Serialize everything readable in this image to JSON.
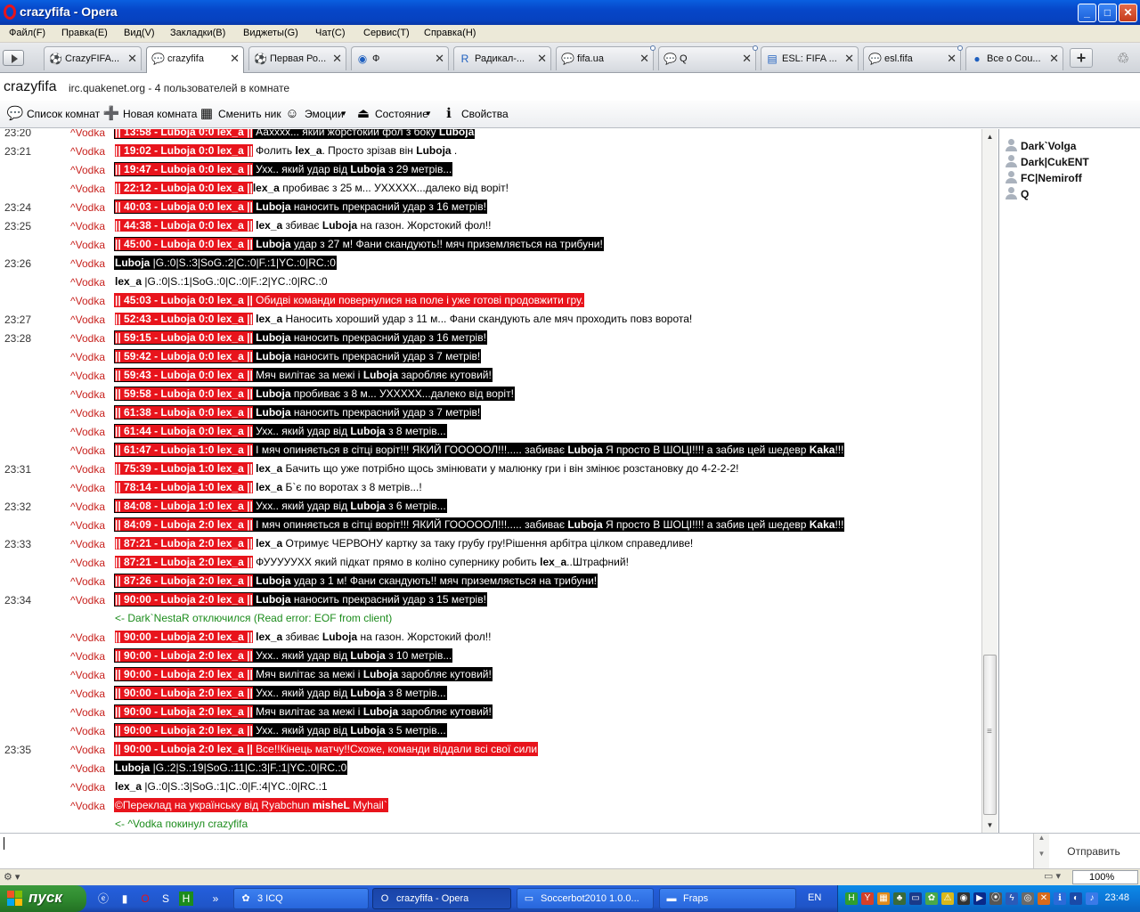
{
  "window": {
    "title": "crazyfifa - Opera",
    "buttons": {
      "minimize": "_",
      "maximize": "□",
      "close": "✕"
    }
  },
  "menu": [
    "Файл(F)",
    "Правка(E)",
    "Вид(V)",
    "Закладки(B)",
    "Виджеты(G)",
    "Чат(C)",
    "Сервис(T)",
    "Справка(H)"
  ],
  "tabs": [
    {
      "label": "CrazyFIFA...",
      "icon": "soccer-ball-icon",
      "glyph": "⚽",
      "active": false,
      "dot": false
    },
    {
      "label": "crazyfifa",
      "icon": "chat-bubble-icon",
      "glyph": "💬",
      "active": true,
      "dot": false
    },
    {
      "label": "Первая Ро...",
      "icon": "soccer-ball-icon",
      "glyph": "⚽",
      "active": false,
      "dot": false
    },
    {
      "label": "Ф",
      "icon": "shield-icon",
      "glyph": "◉",
      "active": false,
      "dot": false
    },
    {
      "label": "Радикал-...",
      "icon": "radikal-icon",
      "glyph": "R",
      "active": false,
      "dot": false
    },
    {
      "label": "fifa.ua",
      "icon": "chat-bubble-icon",
      "glyph": "💬",
      "active": false,
      "dot": true
    },
    {
      "label": "Q",
      "icon": "chat-bubble-icon",
      "glyph": "💬",
      "active": false,
      "dot": true
    },
    {
      "label": "ESL: FIFA ...",
      "icon": "esl-icon",
      "glyph": "▤",
      "active": false,
      "dot": false
    },
    {
      "label": "esl.fifa",
      "icon": "chat-bubble-icon",
      "glyph": "💬",
      "active": false,
      "dot": true
    },
    {
      "label": "Все о Cou...",
      "icon": "dots-icon",
      "glyph": "●",
      "active": false,
      "dot": false
    }
  ],
  "tab_grip": "•••",
  "room": {
    "name": "crazyfifa",
    "info": "irc.quakenet.org - 4 пользователей в комнате"
  },
  "toolbar": [
    {
      "label": "Список комнат",
      "icon": "rooms-list-icon",
      "glyph": "💬",
      "menu": false
    },
    {
      "label": "Новая комната",
      "icon": "new-room-icon",
      "glyph": "➕",
      "menu": false
    },
    {
      "label": "Сменить ник",
      "icon": "change-nick-icon",
      "glyph": "▦",
      "menu": false
    },
    {
      "label": "Эмоции",
      "icon": "smiley-icon",
      "glyph": "☺",
      "menu": true
    },
    {
      "label": "Состояние",
      "icon": "status-icon",
      "glyph": "⏏",
      "menu": true
    },
    {
      "label": "Свойства",
      "icon": "info-icon",
      "glyph": "ℹ",
      "menu": false
    }
  ],
  "chat": [
    {
      "time": "23:20",
      "nick": "^Vodka",
      "style": "blk",
      "parts": [
        [
          "p",
          "|| 13:58 - Luboja 0:0 lex_a ||"
        ],
        [
          "t",
          " Аахххх... який жорстокий фол з боку "
        ],
        [
          "b",
          "Luboja"
        ]
      ]
    },
    {
      "time": "23:21",
      "nick": "^Vodka",
      "style": "wht",
      "parts": [
        [
          "p",
          "|| 19:02 - Luboja 0:0 lex_a ||"
        ],
        [
          "t",
          " Фолить "
        ],
        [
          "b",
          "lex_a"
        ],
        [
          "t",
          ". Просто зрізав він "
        ],
        [
          "b",
          "Luboja"
        ],
        [
          "t",
          " ."
        ]
      ]
    },
    {
      "time": "",
      "nick": "^Vodka",
      "style": "blk",
      "parts": [
        [
          "p",
          "|| 19:47 - Luboja 0:0 lex_a ||"
        ],
        [
          "t",
          " Ухх.. який удар від "
        ],
        [
          "b",
          "Luboja"
        ],
        [
          "t",
          " з 29 метрів..."
        ]
      ]
    },
    {
      "time": "",
      "nick": "^Vodka",
      "style": "wht",
      "parts": [
        [
          "p",
          "|| 22:12 - Luboja 0:0 lex_a ||"
        ],
        [
          "b",
          "lex_a"
        ],
        [
          "t",
          " пробиває з 25 м... УХХХХХ...далеко від воріт!"
        ]
      ]
    },
    {
      "time": "23:24",
      "nick": "^Vodka",
      "style": "blk",
      "parts": [
        [
          "p",
          "|| 40:03 - Luboja 0:0 lex_a ||"
        ],
        [
          "b",
          " Luboja"
        ],
        [
          "t",
          " наносить прекрасний удар з 16 метрів!"
        ]
      ]
    },
    {
      "time": "23:25",
      "nick": "^Vodka",
      "style": "wht",
      "parts": [
        [
          "p",
          "|| 44:38 - Luboja 0:0 lex_a ||"
        ],
        [
          "b",
          " lex_a"
        ],
        [
          "t",
          " збиває "
        ],
        [
          "b",
          "Luboja"
        ],
        [
          "t",
          " на газон. Жорстокий фол!!"
        ]
      ]
    },
    {
      "time": "",
      "nick": "^Vodka",
      "style": "blk",
      "parts": [
        [
          "p",
          "|| 45:00 - Luboja 0:0 lex_a ||"
        ],
        [
          "b",
          " Luboja"
        ],
        [
          "t",
          " удар з 27 м! Фани скандують!! мяч приземляється на трибуни!"
        ]
      ]
    },
    {
      "time": "23:26",
      "nick": "^Vodka",
      "style": "blk",
      "parts": [
        [
          "b",
          "Luboja"
        ],
        [
          "t",
          " |G.:0|S.:3|SoG.:2|C.:0|F.:1|YC.:0|RC.:0"
        ]
      ]
    },
    {
      "time": "",
      "nick": "^Vodka",
      "style": "wht",
      "parts": [
        [
          "b",
          "lex_a"
        ],
        [
          "t",
          " |G.:0|S.:1|SoG.:0|C.:0|F.:2|YC.:0|RC.:0"
        ]
      ]
    },
    {
      "time": "",
      "nick": "^Vodka",
      "style": "red",
      "parts": [
        [
          "p",
          "|| 45:03 - Luboja 0:0 lex_a ||"
        ],
        [
          "t",
          " Обидві команди повернулися на поле і уже готові продовжити гру."
        ]
      ]
    },
    {
      "time": "23:27",
      "nick": "^Vodka",
      "style": "wht",
      "parts": [
        [
          "p",
          "|| 52:43 - Luboja 0:0 lex_a ||"
        ],
        [
          "b",
          " lex_a"
        ],
        [
          "t",
          " Наносить хороший удар з 11 м... Фани скандують але мяч проходить повз ворота!"
        ]
      ]
    },
    {
      "time": "23:28",
      "nick": "^Vodka",
      "style": "blk",
      "parts": [
        [
          "p",
          "|| 59:15 - Luboja 0:0 lex_a ||"
        ],
        [
          "b",
          " Luboja"
        ],
        [
          "t",
          " наносить прекрасний удар з 16 метрів!"
        ]
      ]
    },
    {
      "time": "",
      "nick": "^Vodka",
      "style": "blk",
      "parts": [
        [
          "p",
          "|| 59:42 - Luboja 0:0 lex_a ||"
        ],
        [
          "b",
          " Luboja"
        ],
        [
          "t",
          " наносить прекрасний удар з 7 метрів!"
        ]
      ]
    },
    {
      "time": "",
      "nick": "^Vodka",
      "style": "blk",
      "parts": [
        [
          "p",
          "|| 59:43 - Luboja 0:0 lex_a ||"
        ],
        [
          "t",
          " Мяч вилітає за межі і "
        ],
        [
          "b",
          "Luboja"
        ],
        [
          "t",
          " заробляє кутовий!"
        ]
      ]
    },
    {
      "time": "",
      "nick": "^Vodka",
      "style": "blk",
      "parts": [
        [
          "p",
          "|| 59:58 - Luboja 0:0 lex_a ||"
        ],
        [
          "b",
          " Luboja"
        ],
        [
          "t",
          " пробиває з 8 м... УХХХХХ...далеко від воріт!"
        ]
      ]
    },
    {
      "time": "",
      "nick": "^Vodka",
      "style": "blk",
      "parts": [
        [
          "p",
          "|| 61:38 - Luboja 0:0 lex_a ||"
        ],
        [
          "b",
          " Luboja"
        ],
        [
          "t",
          " наносить прекрасний удар з 7 метрів!"
        ]
      ]
    },
    {
      "time": "",
      "nick": "^Vodka",
      "style": "blk",
      "parts": [
        [
          "p",
          "|| 61:44 - Luboja 0:0 lex_a ||"
        ],
        [
          "t",
          " Ухх.. який удар від "
        ],
        [
          "b",
          "Luboja"
        ],
        [
          "t",
          " з 8 метрів..."
        ]
      ]
    },
    {
      "time": "",
      "nick": "^Vodka",
      "style": "blk",
      "parts": [
        [
          "p",
          "|| 61:47 - Luboja 1:0 lex_a ||"
        ],
        [
          "t",
          " І мяч опиняється в сітці воріт!!! ЯКИЙ ГОООООЛ!!!..... забиває "
        ],
        [
          "b",
          "Luboja"
        ],
        [
          "t",
          " Я просто В ШОЦІ!!!! а забив цей шедевр "
        ],
        [
          "b",
          "Kaka"
        ],
        [
          "t",
          "!!!"
        ]
      ]
    },
    {
      "time": "23:31",
      "nick": "^Vodka",
      "style": "wht",
      "parts": [
        [
          "p",
          "|| 75:39 - Luboja 1:0 lex_a ||"
        ],
        [
          "b",
          " lex_a"
        ],
        [
          "t",
          " Бачить що уже потрібно щось змінювати у малюнку гри і він змінює розстановку до 4-2-2-2!"
        ]
      ]
    },
    {
      "time": "",
      "nick": "^Vodka",
      "style": "wht",
      "parts": [
        [
          "p",
          "|| 78:14 - Luboja 1:0 lex_a ||"
        ],
        [
          "b",
          " lex_a"
        ],
        [
          "t",
          " Б`є по воротах з 8 метрів...!"
        ]
      ]
    },
    {
      "time": "23:32",
      "nick": "^Vodka",
      "style": "blk",
      "parts": [
        [
          "p",
          "|| 84:08 - Luboja 1:0 lex_a ||"
        ],
        [
          "t",
          " Ухх.. який удар від "
        ],
        [
          "b",
          "Luboja"
        ],
        [
          "t",
          " з 6 метрів..."
        ]
      ]
    },
    {
      "time": "",
      "nick": "^Vodka",
      "style": "blk",
      "parts": [
        [
          "p",
          "|| 84:09 - Luboja 2:0 lex_a ||"
        ],
        [
          "t",
          " І мяч опиняється в сітці воріт!!! ЯКИЙ ГОООООЛ!!!..... забиває "
        ],
        [
          "b",
          "Luboja"
        ],
        [
          "t",
          " Я просто В ШОЦІ!!!! а забив цей шедевр "
        ],
        [
          "b",
          "Kaka"
        ],
        [
          "t",
          "!!!"
        ]
      ]
    },
    {
      "time": "23:33",
      "nick": "^Vodka",
      "style": "wht",
      "parts": [
        [
          "p",
          "|| 87:21 - Luboja 2:0 lex_a ||"
        ],
        [
          "b",
          " lex_a"
        ],
        [
          "t",
          " Отримує ЧЕРВОНУ картку за таку грубу гру!Рішення арбітра цілком справедливе!"
        ]
      ]
    },
    {
      "time": "",
      "nick": "^Vodka",
      "style": "wht",
      "parts": [
        [
          "p",
          "|| 87:21 - Luboja 2:0 lex_a ||"
        ],
        [
          "t",
          " ФУУУУУХХ який підкат прямо в коліно супернику робить "
        ],
        [
          "b",
          "lex_a"
        ],
        [
          "t",
          "..Штрафний!"
        ]
      ]
    },
    {
      "time": "",
      "nick": "^Vodka",
      "style": "blk",
      "parts": [
        [
          "p",
          "|| 87:26 - Luboja 2:0 lex_a ||"
        ],
        [
          "b",
          " Luboja"
        ],
        [
          "t",
          " удар з 1 м! Фани скандують!! мяч приземляється на трибуни!"
        ]
      ]
    },
    {
      "time": "23:34",
      "nick": "^Vodka",
      "style": "blk",
      "parts": [
        [
          "p",
          "|| 90:00 - Luboja 2:0 lex_a ||"
        ],
        [
          "b",
          " Luboja"
        ],
        [
          "t",
          " наносить прекрасний удар з 15 метрів!"
        ]
      ]
    },
    {
      "time": "",
      "nick": "",
      "style": "green",
      "parts": [
        [
          "t",
          "<- Dark`NestaR отключился (Read error: EOF from client)"
        ]
      ]
    },
    {
      "time": "",
      "nick": "^Vodka",
      "style": "wht",
      "parts": [
        [
          "p",
          "|| 90:00 - Luboja 2:0 lex_a ||"
        ],
        [
          "b",
          " lex_a"
        ],
        [
          "t",
          " збиває "
        ],
        [
          "b",
          "Luboja"
        ],
        [
          "t",
          " на газон. Жорстокий фол!!"
        ]
      ]
    },
    {
      "time": "",
      "nick": "^Vodka",
      "style": "blk",
      "parts": [
        [
          "p",
          "|| 90:00 - Luboja 2:0 lex_a ||"
        ],
        [
          "t",
          " Ухх.. який удар від "
        ],
        [
          "b",
          "Luboja"
        ],
        [
          "t",
          " з 10 метрів..."
        ]
      ]
    },
    {
      "time": "",
      "nick": "^Vodka",
      "style": "blk",
      "parts": [
        [
          "p",
          "|| 90:00 - Luboja 2:0 lex_a ||"
        ],
        [
          "t",
          " Мяч вилітає за межі і "
        ],
        [
          "b",
          "Luboja"
        ],
        [
          "t",
          " заробляє кутовий!"
        ]
      ]
    },
    {
      "time": "",
      "nick": "^Vodka",
      "style": "blk",
      "parts": [
        [
          "p",
          "|| 90:00 - Luboja 2:0 lex_a ||"
        ],
        [
          "t",
          " Ухх.. який удар від "
        ],
        [
          "b",
          "Luboja"
        ],
        [
          "t",
          " з 8 метрів..."
        ]
      ]
    },
    {
      "time": "",
      "nick": "^Vodka",
      "style": "blk",
      "parts": [
        [
          "p",
          "|| 90:00 - Luboja 2:0 lex_a ||"
        ],
        [
          "t",
          " Мяч вилітає за межі і "
        ],
        [
          "b",
          "Luboja"
        ],
        [
          "t",
          " заробляє кутовий!"
        ]
      ]
    },
    {
      "time": "",
      "nick": "^Vodka",
      "style": "blk",
      "parts": [
        [
          "p",
          "|| 90:00 - Luboja 2:0 lex_a ||"
        ],
        [
          "t",
          " Ухх.. який удар від "
        ],
        [
          "b",
          "Luboja"
        ],
        [
          "t",
          " з 5 метрів..."
        ]
      ]
    },
    {
      "time": "23:35",
      "nick": "^Vodka",
      "style": "red",
      "parts": [
        [
          "p",
          "|| 90:00 - Luboja 2:0 lex_a ||"
        ],
        [
          "t",
          " Все!!Кінець матчу!!Схоже, команди віддали всі свої сили"
        ]
      ]
    },
    {
      "time": "",
      "nick": "^Vodka",
      "style": "blk",
      "parts": [
        [
          "b",
          "Luboja"
        ],
        [
          "t",
          " |G.:2|S.:19|SoG.:11|C.:3|F.:1|YC.:0|RC.:0"
        ]
      ]
    },
    {
      "time": "",
      "nick": "^Vodka",
      "style": "wht",
      "parts": [
        [
          "b",
          "lex_a"
        ],
        [
          "t",
          " |G.:0|S.:3|SoG.:1|C.:0|F.:4|YC.:0|RC.:1"
        ]
      ]
    },
    {
      "time": "",
      "nick": "^Vodka",
      "style": "red",
      "parts": [
        [
          "t",
          "©Переклад на українську від Ryabchun "
        ],
        [
          "b",
          "misheL"
        ],
        [
          "t",
          " Myhail`"
        ]
      ]
    },
    {
      "time": "",
      "nick": "",
      "style": "green",
      "parts": [
        [
          "t",
          "<- ^Vodka покинул crazyfifa"
        ]
      ]
    }
  ],
  "users": [
    "Dark`Volga",
    "Dark|CukENT",
    "FC|Nemiroff",
    "Q"
  ],
  "input": {
    "value": "",
    "send_label": "Отправить"
  },
  "statusbar": {
    "zoom": "100%"
  },
  "taskbar": {
    "start_label": "пуск",
    "tasks": [
      {
        "label": "3 ICQ",
        "icon": "icq-icon",
        "glyph": "✿",
        "active": false
      },
      {
        "label": "crazyfifa - Opera",
        "icon": "opera-icon",
        "glyph": "O",
        "active": true
      },
      {
        "label": "Soccerbot2010 1.0.0...",
        "icon": "soccerbot-icon",
        "glyph": "▭",
        "active": false
      },
      {
        "label": "Fraps",
        "icon": "folder-icon",
        "glyph": "▬",
        "active": false
      }
    ],
    "lang": "EN",
    "clock": "23:48"
  },
  "colors": {
    "accent_red": "#e8141c",
    "nick_red": "#c8231f",
    "system_green": "#1c8c1c"
  }
}
